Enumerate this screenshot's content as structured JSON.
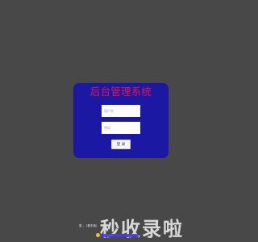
{
  "login": {
    "title": "后台管理系统",
    "username_placeholder": "用户名",
    "password_placeholder": "密码",
    "submit_label": "登 录"
  },
  "watermark": {
    "text": "秒收录啦",
    "note": "更...（看不清）"
  },
  "colors": {
    "background": "#484848",
    "panel": "#1b19a3",
    "title": "#e8134f"
  }
}
